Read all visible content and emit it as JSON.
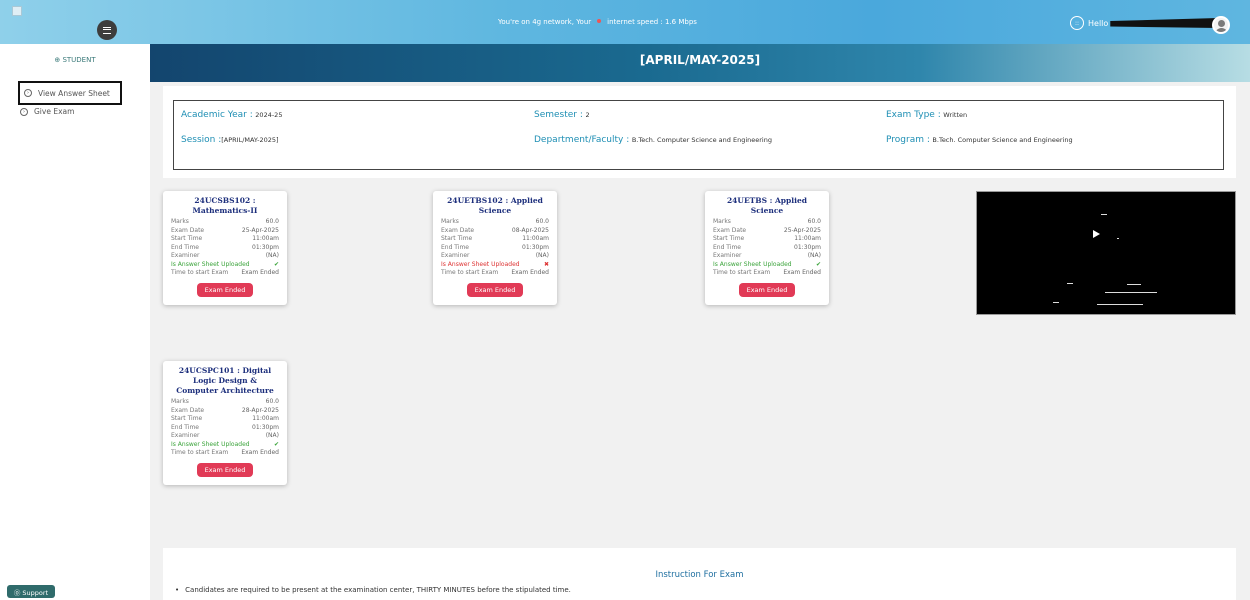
{
  "topbar": {
    "network_text": "You're on 4g network, Your",
    "speed_text": "internet speed : 1.6 Mbps",
    "hello": "Hello"
  },
  "sidebar": {
    "role": "⊕ STUDENT",
    "items": [
      {
        "label": "View Answer Sheet",
        "icon": "arrow-right-circle-icon"
      },
      {
        "label": "Give Exam",
        "icon": "arrow-right-circle-icon"
      }
    ],
    "support": "⓪ Support"
  },
  "header": {
    "title": "[APRIL/MAY-2025]"
  },
  "info": {
    "academic_year_label": "Academic Year :",
    "academic_year": "2024-25",
    "semester_label": "Semester :",
    "semester": "2",
    "exam_type_label": "Exam Type :",
    "exam_type": "Written",
    "session_label": "Session :",
    "session": "[APRIL/MAY-2025]",
    "department_label": "Department/Faculty :",
    "department": "B.Tech. Computer Science and Engineering",
    "program_label": "Program :",
    "program": "B.Tech. Computer Science and Engineering"
  },
  "row_labels": {
    "marks": "Marks",
    "exam_date": "Exam Date",
    "start_time": "Start Time",
    "end_time": "End Time",
    "examiner": "Examiner",
    "uploaded": "Is Answer Sheet Uploaded",
    "time_to_start": "Time to start Exam"
  },
  "cards": [
    {
      "title": "24UCSBS102 : Mathematics-II",
      "marks": "60.0",
      "exam_date": "25-Apr-2025",
      "start_time": "11:00am",
      "end_time": "01:30pm",
      "examiner": "(NA)",
      "uploaded": "✔",
      "uploaded_status": "yes",
      "time_to_start": "Exam Ended",
      "button": "Exam Ended"
    },
    {
      "title": "24UETBS102 : Applied Science",
      "marks": "60.0",
      "exam_date": "08-Apr-2025",
      "start_time": "11:00am",
      "end_time": "01:30pm",
      "examiner": "(NA)",
      "uploaded": "✖",
      "uploaded_status": "no",
      "time_to_start": "Exam Ended",
      "button": "Exam Ended"
    },
    {
      "title": "24UETBS : Applied Science",
      "marks": "60.0",
      "exam_date": "25-Apr-2025",
      "start_time": "11:00am",
      "end_time": "01:30pm",
      "examiner": "(NA)",
      "uploaded": "✔",
      "uploaded_status": "yes",
      "time_to_start": "Exam Ended",
      "button": "Exam Ended"
    },
    {
      "title": "24UCSPC101 : Digital Logic Design & Computer Architecture",
      "marks": "60.0",
      "exam_date": "28-Apr-2025",
      "start_time": "11:00am",
      "end_time": "01:30pm",
      "examiner": "(NA)",
      "uploaded": "✔",
      "uploaded_status": "yes",
      "time_to_start": "Exam Ended",
      "button": "Exam Ended"
    }
  ],
  "instructions": {
    "title": "Instruction For Exam",
    "items": [
      "Candidates are required to be present at the examination center, THIRTY MINUTES before the stipulated time."
    ]
  },
  "colors": {
    "accent": "#1f8fb4",
    "button": "#e13a56",
    "success": "#3aa33a",
    "danger": "#d33333"
  }
}
